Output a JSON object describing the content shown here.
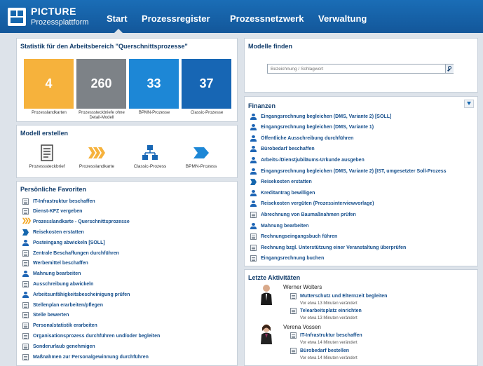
{
  "app": {
    "title": "PICTURE",
    "subtitle": "Prozessplattform"
  },
  "nav": {
    "items": [
      {
        "label": "Start",
        "active": true
      },
      {
        "label": "Prozessregister"
      },
      {
        "label": "Prozessnetzwerk"
      },
      {
        "label": "Verwaltung"
      }
    ]
  },
  "statistik": {
    "title": "Statistik für den Arbeitsbereich \"Querschnittsprozesse\"",
    "tiles": [
      {
        "value": "4",
        "label": "Prozesslandkarten",
        "color": "#f6b23c"
      },
      {
        "value": "260",
        "label": "Prozesssteckbriefe ohne Detail-Modell",
        "color": "#7d8287"
      },
      {
        "value": "33",
        "label": "BPMN-Prozesse",
        "color": "#1d87d6"
      },
      {
        "value": "37",
        "label": "Classic-Prozesse",
        "color": "#1766b4"
      }
    ]
  },
  "modell_erstellen": {
    "title": "Modell erstellen",
    "items": [
      {
        "label": "Prozesssteckbrief",
        "icon": "document-icon"
      },
      {
        "label": "Prozesslandkarte",
        "icon": "chevron-map-icon"
      },
      {
        "label": "Classic-Prozess",
        "icon": "hierarchy-icon"
      },
      {
        "label": "BPMN-Prozess",
        "icon": "arrow-process-icon"
      }
    ]
  },
  "favoriten": {
    "title": "Persönliche Favoriten",
    "items": [
      {
        "label": "IT-Infrastruktur beschaffen",
        "icon": "doc"
      },
      {
        "label": "Dienst-KFZ vergeben",
        "icon": "doc"
      },
      {
        "label": "Prozesslandkarte - Querschnittsprozesse",
        "icon": "chev"
      },
      {
        "label": "Reisekosten erstatten",
        "icon": "arrow"
      },
      {
        "label": "Posteingang abwickeln [SOLL]",
        "icon": "user"
      },
      {
        "label": "Zentrale Beschaffungen durchführen",
        "icon": "doc"
      },
      {
        "label": "Werbemittel beschaffen",
        "icon": "doc"
      },
      {
        "label": "Mahnung bearbeiten",
        "icon": "user"
      },
      {
        "label": "Ausschreibung abwickeln",
        "icon": "doc"
      },
      {
        "label": "Arbeitsunfähigkeitsbescheinigung prüfen",
        "icon": "user"
      },
      {
        "label": "Stellenplan erarbeiten/pflegen",
        "icon": "doc"
      },
      {
        "label": "Stelle bewerten",
        "icon": "doc"
      },
      {
        "label": "Personalstatistik erarbeiten",
        "icon": "doc"
      },
      {
        "label": "Organisationsprozess durchführen und/oder begleiten",
        "icon": "doc"
      },
      {
        "label": "Sonderurlaub genehmigen",
        "icon": "doc"
      },
      {
        "label": "Maßnahmen zur Personalgewinnung durchführen",
        "icon": "doc"
      }
    ]
  },
  "modelle_finden": {
    "title": "Modelle finden",
    "search_placeholder": "Bezeichnung / Schlagwort"
  },
  "finanzen": {
    "title": "Finanzen",
    "items": [
      {
        "label": "Eingangsrechnung begleichen (DMS, Variante 2) [SOLL]",
        "icon": "user"
      },
      {
        "label": "Eingangsrechnung begleichen (DMS, Variante 1)",
        "icon": "user"
      },
      {
        "label": "Öffentliche Ausschreibung durchführen",
        "icon": "user"
      },
      {
        "label": "Bürobedarf beschaffen",
        "icon": "user"
      },
      {
        "label": "Arbeits-/Dienstjubiläums-Urkunde ausgeben",
        "icon": "user"
      },
      {
        "label": "Eingangsrechnung begleichen (DMS, Variante 2) [IST, umgesetzter Soll-Prozess",
        "icon": "user"
      },
      {
        "label": "Reisekosten erstatten",
        "icon": "arrow"
      },
      {
        "label": "Kreditantrag bewilligen",
        "icon": "user"
      },
      {
        "label": "Reisekosten vergüten (Prozessinterviewvorlage)",
        "icon": "user"
      },
      {
        "label": "Abrechnung von Baumaßnahmen prüfen",
        "icon": "doc"
      },
      {
        "label": "Mahnung bearbeiten",
        "icon": "user"
      },
      {
        "label": "Rechnungseingangsbuch führen",
        "icon": "doc"
      },
      {
        "label": "Rechnung bzgl. Unterstützung einer Veranstaltung überprüfen",
        "icon": "doc"
      },
      {
        "label": "Eingangsrechnung buchen",
        "icon": "doc"
      }
    ]
  },
  "aktivitaeten": {
    "title": "Letzte Aktivitäten",
    "users": [
      {
        "name": "Werner Wolters",
        "entries": [
          {
            "label": "Mutterschutz und Elternzeit begleiten",
            "time": "Vor etwa 13 Minuten verändert"
          },
          {
            "label": "Telearbeitsplatz einrichten",
            "time": "Vor etwa 13 Minuten verändert"
          }
        ]
      },
      {
        "name": "Verena Vossen",
        "entries": [
          {
            "label": "IT-Infrastruktur beschaffen",
            "time": "Vor etwa 14 Minuten verändert"
          },
          {
            "label": "Bürobedarf bestellen",
            "time": "Vor etwa 14 Minuten verändert"
          }
        ]
      }
    ]
  }
}
